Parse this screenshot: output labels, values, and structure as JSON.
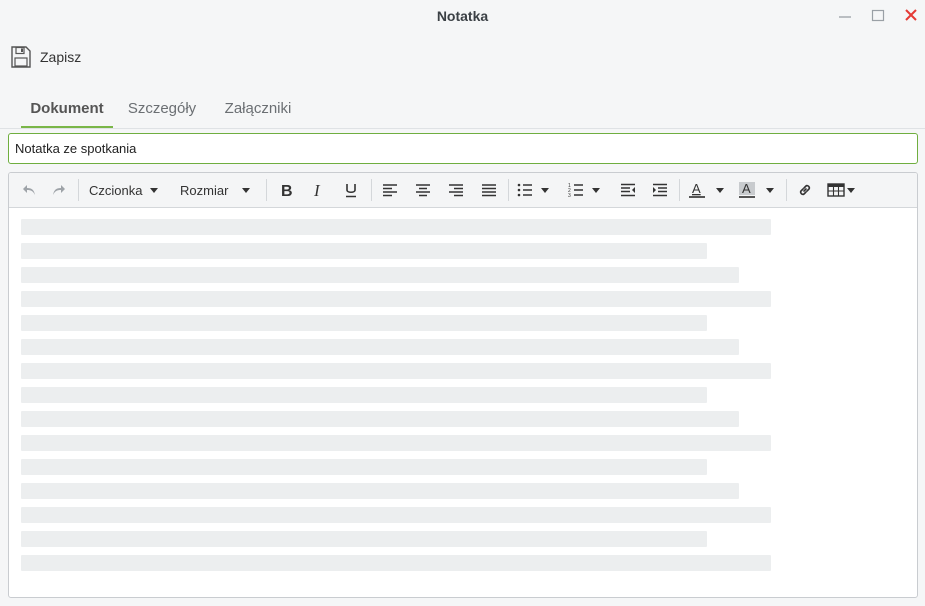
{
  "window": {
    "title": "Notatka"
  },
  "toolbar_main": {
    "save_label": "Zapisz"
  },
  "tabs": [
    {
      "label": "Dokument",
      "active": true
    },
    {
      "label": "Szczegóły",
      "active": false
    },
    {
      "label": "Załączniki",
      "active": false
    }
  ],
  "title_field": {
    "value": "Notatka ze spotkania"
  },
  "editor_toolbar": {
    "font_label": "Czcionka",
    "size_label": "Rozmiar"
  },
  "colors": {
    "accent": "#7ab648",
    "close": "#e53935"
  }
}
